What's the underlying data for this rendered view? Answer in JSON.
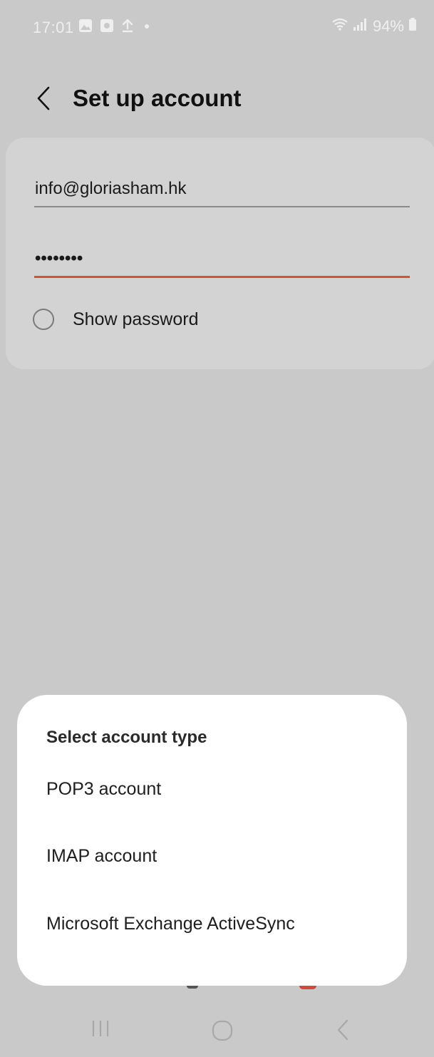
{
  "status_bar": {
    "time": "17:01",
    "battery": "94%",
    "icons_left": [
      "gallery-icon",
      "screen-record-icon",
      "upload-icon",
      "dot-icon"
    ],
    "icons_right": [
      "wifi-icon",
      "signal-icon",
      "battery-icon"
    ]
  },
  "header": {
    "title": "Set up account",
    "back_icon": "chevron-left-icon"
  },
  "form": {
    "email_value": "info@gloriasham.hk",
    "password_value": "••••••••",
    "show_password_label": "Show password",
    "show_password_checked": false,
    "accent_color": "#d0552a"
  },
  "sheet": {
    "title": "Select account type",
    "options": [
      {
        "label": "POP3 account"
      },
      {
        "label": "IMAP account"
      },
      {
        "label": "Microsoft Exchange ActiveSync"
      }
    ]
  },
  "nav": {
    "recents_icon": "recents-icon",
    "home_icon": "home-icon",
    "back_icon": "back-icon"
  }
}
